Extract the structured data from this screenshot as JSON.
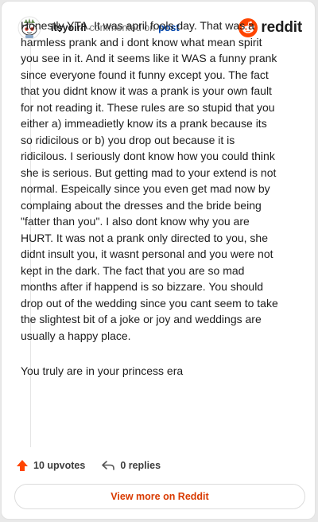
{
  "header": {
    "username": "itsyoirll",
    "commented_text": "commented on",
    "post_link": "post",
    "brand_name": "reddit",
    "brand_color": "#ff4500"
  },
  "comment": {
    "body": "Honestly YTA. It was april fools day. That was a harmless prank and i dont know what mean spirit you see in it. And it seems like it WAS a funny prank since everyone found it funny except you. The fact that you didnt know it was a prank is your own fault for not reading it. These rules are so stupid that you either a) immeadietly know its a prank because its so ridicilous or b) you drop out because it is ridicilous. I seriously dont know how you could think she is serious. But getting mad to your extend is not normal. Espeically since you even get mad now by complaing about the dresses and the bride being \"fatter than you\". I also dont know why you are HURT. It was not a prank only directed to you, she didnt insult you, it wasnt personal and you were not kept in the dark. The fact that you are so mad months after if happend is so bizzare. You should drop out of the wedding since you cant seem to take the slightest bit of a joke or joy and weddings are usually a happy place.",
    "closing": "You truly are in your princess era"
  },
  "actions": {
    "upvotes_label": "10 upvotes",
    "replies_label": "0 replies",
    "upvote_icon": "upvote-arrow-icon",
    "reply_icon": "reply-arrow-icon",
    "upvote_color": "#ff4500"
  },
  "footer": {
    "view_more_label": "View more on Reddit",
    "view_more_color": "#d93a00"
  }
}
